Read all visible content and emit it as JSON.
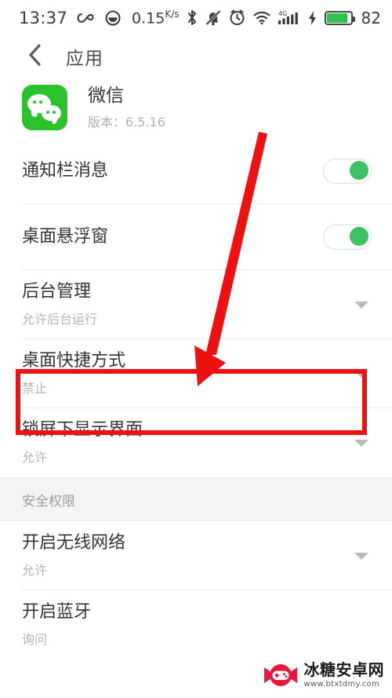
{
  "statusbar": {
    "time": "13:37",
    "icons_left": [
      "infinity-icon",
      "face-icon"
    ],
    "net_speed": "0.15",
    "net_speed_unit_top": "K",
    "net_speed_unit_bottom": "s",
    "icons_right": [
      "bluetooth-icon",
      "mute-icon",
      "alarm-icon",
      "wifi-icon",
      "signal-4g-icon",
      "charging-bolt-icon",
      "battery-icon"
    ],
    "signal_label": "4G",
    "battery_percent": "82"
  },
  "header": {
    "back_icon": "chevron-left-icon",
    "title": "应用"
  },
  "app": {
    "icon": "wechat-icon",
    "name": "微信",
    "version_label": "版本：6.5.16"
  },
  "settings": {
    "rows": [
      {
        "title": "通知栏消息",
        "sub": "",
        "control": "switch",
        "switch_on": true
      },
      {
        "title": "桌面悬浮窗",
        "sub": "",
        "control": "switch",
        "switch_on": true
      },
      {
        "title": "后台管理",
        "sub": "允许后台运行",
        "control": "caret"
      },
      {
        "title": "桌面快捷方式",
        "sub": "禁止",
        "control": "caret",
        "highlighted": true
      },
      {
        "title": "锁屏下显示界面",
        "sub": "允许",
        "control": "caret"
      }
    ],
    "section_title": "安全权限",
    "security_rows": [
      {
        "title": "开启无线网络",
        "sub": "允许",
        "control": "caret"
      },
      {
        "title": "开启蓝牙",
        "sub": "询问",
        "control": "caret"
      }
    ]
  },
  "annotation": {
    "highlight_color": "#ee1111",
    "arrow_color": "#ee1111",
    "arrow_name": "red-arrow-pointing-to-desktop-shortcut"
  },
  "watermark": {
    "name": "冰糖安卓网",
    "url": "www.btxtdmy.com",
    "color": "#e8173d"
  },
  "colors": {
    "accent_green": "#3cc261",
    "wechat_green": "#2cc22c",
    "text_primary": "#333333",
    "text_secondary": "#b4b4b4",
    "section_bg": "#f4f4f6"
  }
}
